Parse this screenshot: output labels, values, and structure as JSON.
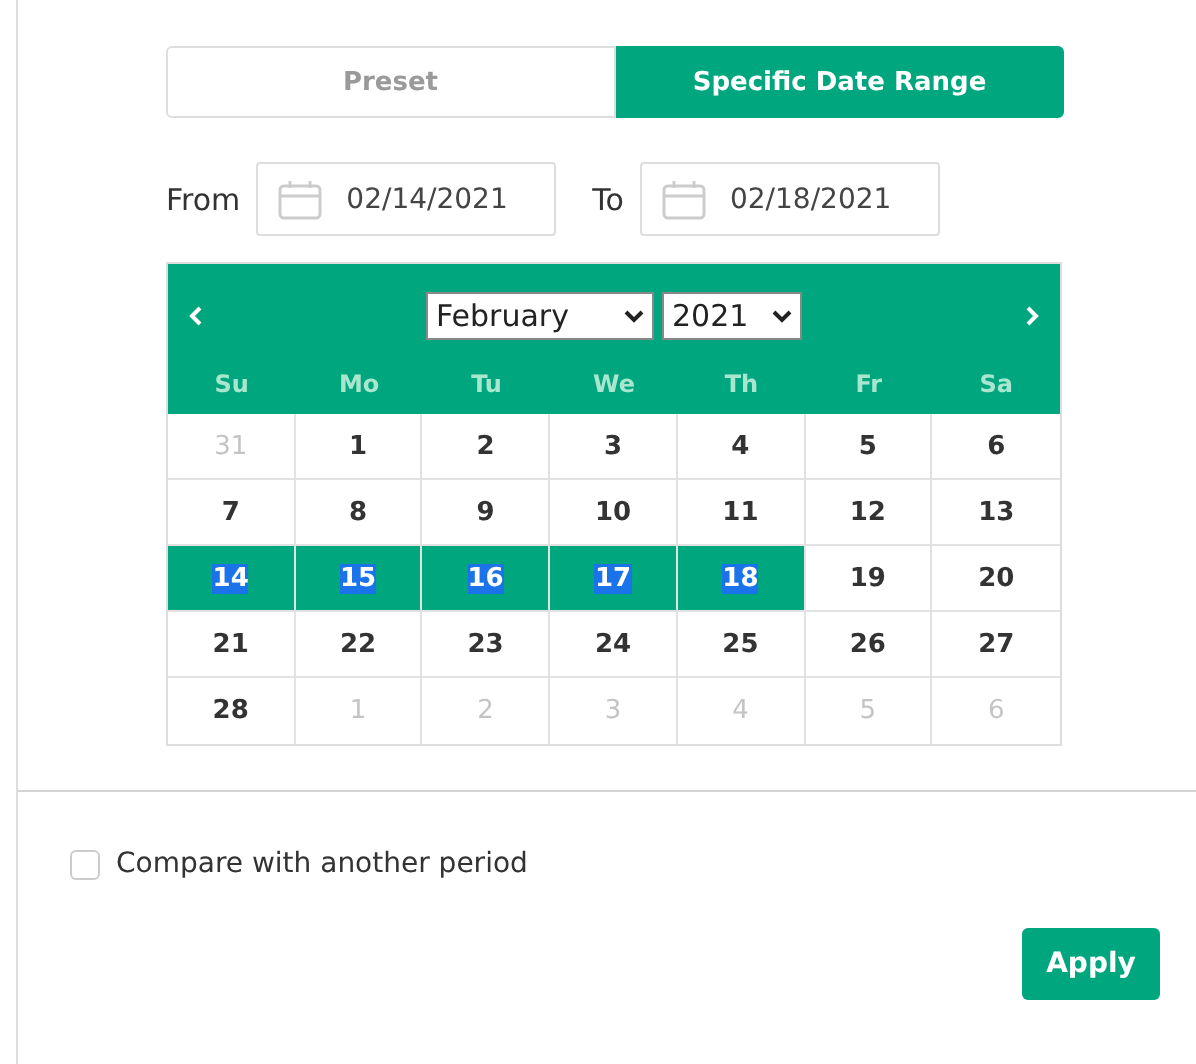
{
  "tabs": [
    {
      "label": "Preset",
      "selected": false
    },
    {
      "label": "Specific Date Range",
      "selected": true
    }
  ],
  "range": {
    "from_label": "From",
    "from_value": "02/14/2021",
    "to_label": "To",
    "to_value": "02/18/2021"
  },
  "calendar": {
    "month": "February",
    "year": "2021",
    "weekdays": [
      "Su",
      "Mo",
      "Tu",
      "We",
      "Th",
      "Fr",
      "Sa"
    ],
    "weeks": [
      [
        {
          "day": "31",
          "muted": true,
          "selected": false
        },
        {
          "day": "1",
          "muted": false,
          "selected": false
        },
        {
          "day": "2",
          "muted": false,
          "selected": false
        },
        {
          "day": "3",
          "muted": false,
          "selected": false
        },
        {
          "day": "4",
          "muted": false,
          "selected": false
        },
        {
          "day": "5",
          "muted": false,
          "selected": false
        },
        {
          "day": "6",
          "muted": false,
          "selected": false
        }
      ],
      [
        {
          "day": "7",
          "muted": false,
          "selected": false
        },
        {
          "day": "8",
          "muted": false,
          "selected": false
        },
        {
          "day": "9",
          "muted": false,
          "selected": false
        },
        {
          "day": "10",
          "muted": false,
          "selected": false
        },
        {
          "day": "11",
          "muted": false,
          "selected": false
        },
        {
          "day": "12",
          "muted": false,
          "selected": false
        },
        {
          "day": "13",
          "muted": false,
          "selected": false
        }
      ],
      [
        {
          "day": "14",
          "muted": false,
          "selected": true
        },
        {
          "day": "15",
          "muted": false,
          "selected": true
        },
        {
          "day": "16",
          "muted": false,
          "selected": true
        },
        {
          "day": "17",
          "muted": false,
          "selected": true
        },
        {
          "day": "18",
          "muted": false,
          "selected": true
        },
        {
          "day": "19",
          "muted": false,
          "selected": false
        },
        {
          "day": "20",
          "muted": false,
          "selected": false
        }
      ],
      [
        {
          "day": "21",
          "muted": false,
          "selected": false
        },
        {
          "day": "22",
          "muted": false,
          "selected": false
        },
        {
          "day": "23",
          "muted": false,
          "selected": false
        },
        {
          "day": "24",
          "muted": false,
          "selected": false
        },
        {
          "day": "25",
          "muted": false,
          "selected": false
        },
        {
          "day": "26",
          "muted": false,
          "selected": false
        },
        {
          "day": "27",
          "muted": false,
          "selected": false
        }
      ],
      [
        {
          "day": "28",
          "muted": false,
          "selected": false
        },
        {
          "day": "1",
          "muted": true,
          "selected": false
        },
        {
          "day": "2",
          "muted": true,
          "selected": false
        },
        {
          "day": "3",
          "muted": true,
          "selected": false
        },
        {
          "day": "4",
          "muted": true,
          "selected": false
        },
        {
          "day": "5",
          "muted": true,
          "selected": false
        },
        {
          "day": "6",
          "muted": true,
          "selected": false
        }
      ]
    ]
  },
  "compare": {
    "label": "Compare with another period",
    "checked": false
  },
  "apply_button": "Apply"
}
